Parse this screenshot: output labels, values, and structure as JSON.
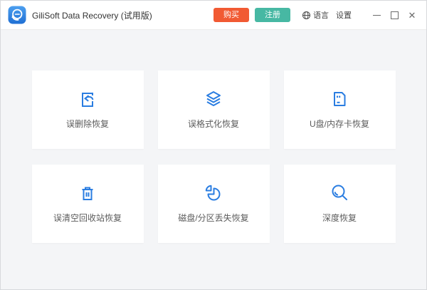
{
  "window": {
    "title": "GiliSoft Data Recovery (试用版)"
  },
  "titlebar": {
    "buy_label": "购买",
    "register_label": "注册",
    "language_label": "语言",
    "settings_label": "设置",
    "icons": {
      "app": "app-logo-icon",
      "language": "globe-icon",
      "minimize": "minimize-icon",
      "maximize": "maximize-icon",
      "close": "close-icon"
    }
  },
  "cards": [
    {
      "label": "误删除恢复",
      "icon": "undelete-file-icon"
    },
    {
      "label": "误格式化恢复",
      "icon": "layers-icon"
    },
    {
      "label": "U盘/内存卡恢复",
      "icon": "memory-card-icon"
    },
    {
      "label": "误清空回收站恢复",
      "icon": "trash-icon"
    },
    {
      "label": "磁盘/分区丢失恢复",
      "icon": "pie-chart-icon"
    },
    {
      "label": "深度恢复",
      "icon": "magnifier-icon"
    }
  ],
  "colors": {
    "accent_blue": "#2A7DE1",
    "buy_orange": "#F15A33",
    "register_teal": "#47B8A3",
    "background": "#F4F5F7"
  }
}
